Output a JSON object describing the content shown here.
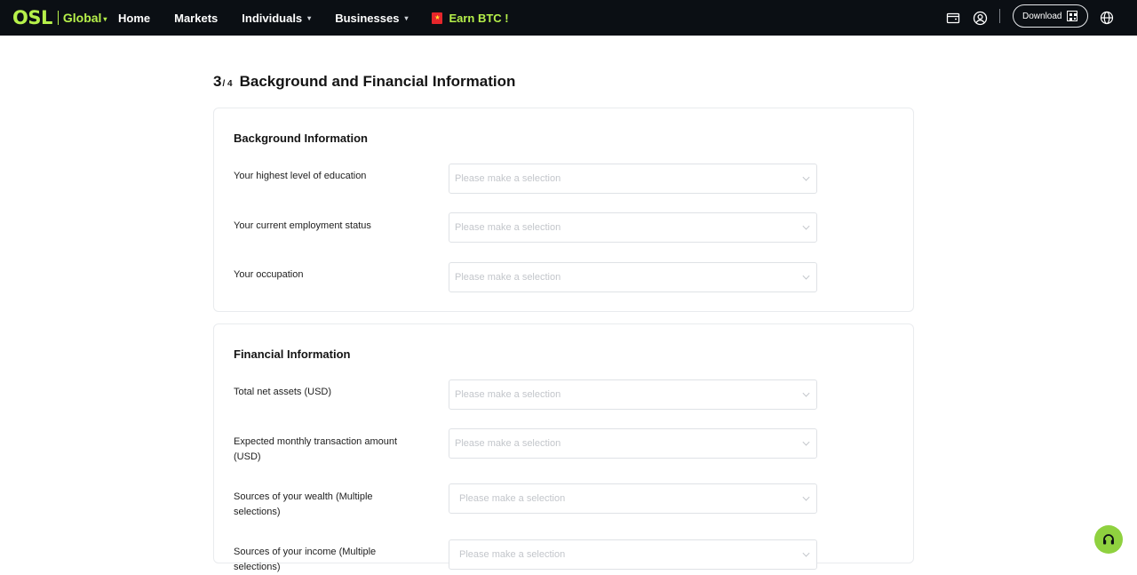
{
  "header": {
    "logo": "OSL",
    "region": "Global",
    "nav": [
      "Home",
      "Markets",
      "Individuals",
      "Businesses"
    ],
    "earn": "Earn BTC !",
    "download_label": "Download"
  },
  "page": {
    "step_current": "3",
    "step_total": "/ 4",
    "title": "Background and Financial Information"
  },
  "background": {
    "title": "Background Information",
    "fields": [
      {
        "label": "Your highest level of education",
        "placeholder": "Please make a selection"
      },
      {
        "label": "Your current employment status",
        "placeholder": "Please make a selection"
      },
      {
        "label": "Your occupation",
        "placeholder": "Please make a selection"
      }
    ]
  },
  "financial": {
    "title": "Financial Information",
    "fields": [
      {
        "label": "Total net assets (USD)",
        "placeholder": "Please make a selection"
      },
      {
        "label": "Expected monthly transaction amount (USD)",
        "placeholder": "Please make a selection"
      },
      {
        "label": "Sources of your wealth (Multiple selections)",
        "placeholder": "Please make a selection"
      },
      {
        "label": "Sources of your income (Multiple selections)",
        "placeholder": "Please make a selection"
      }
    ]
  },
  "colors": {
    "brand": "#b6f04a",
    "nav_bg": "#0b0f14",
    "support": "#8fd13f"
  }
}
